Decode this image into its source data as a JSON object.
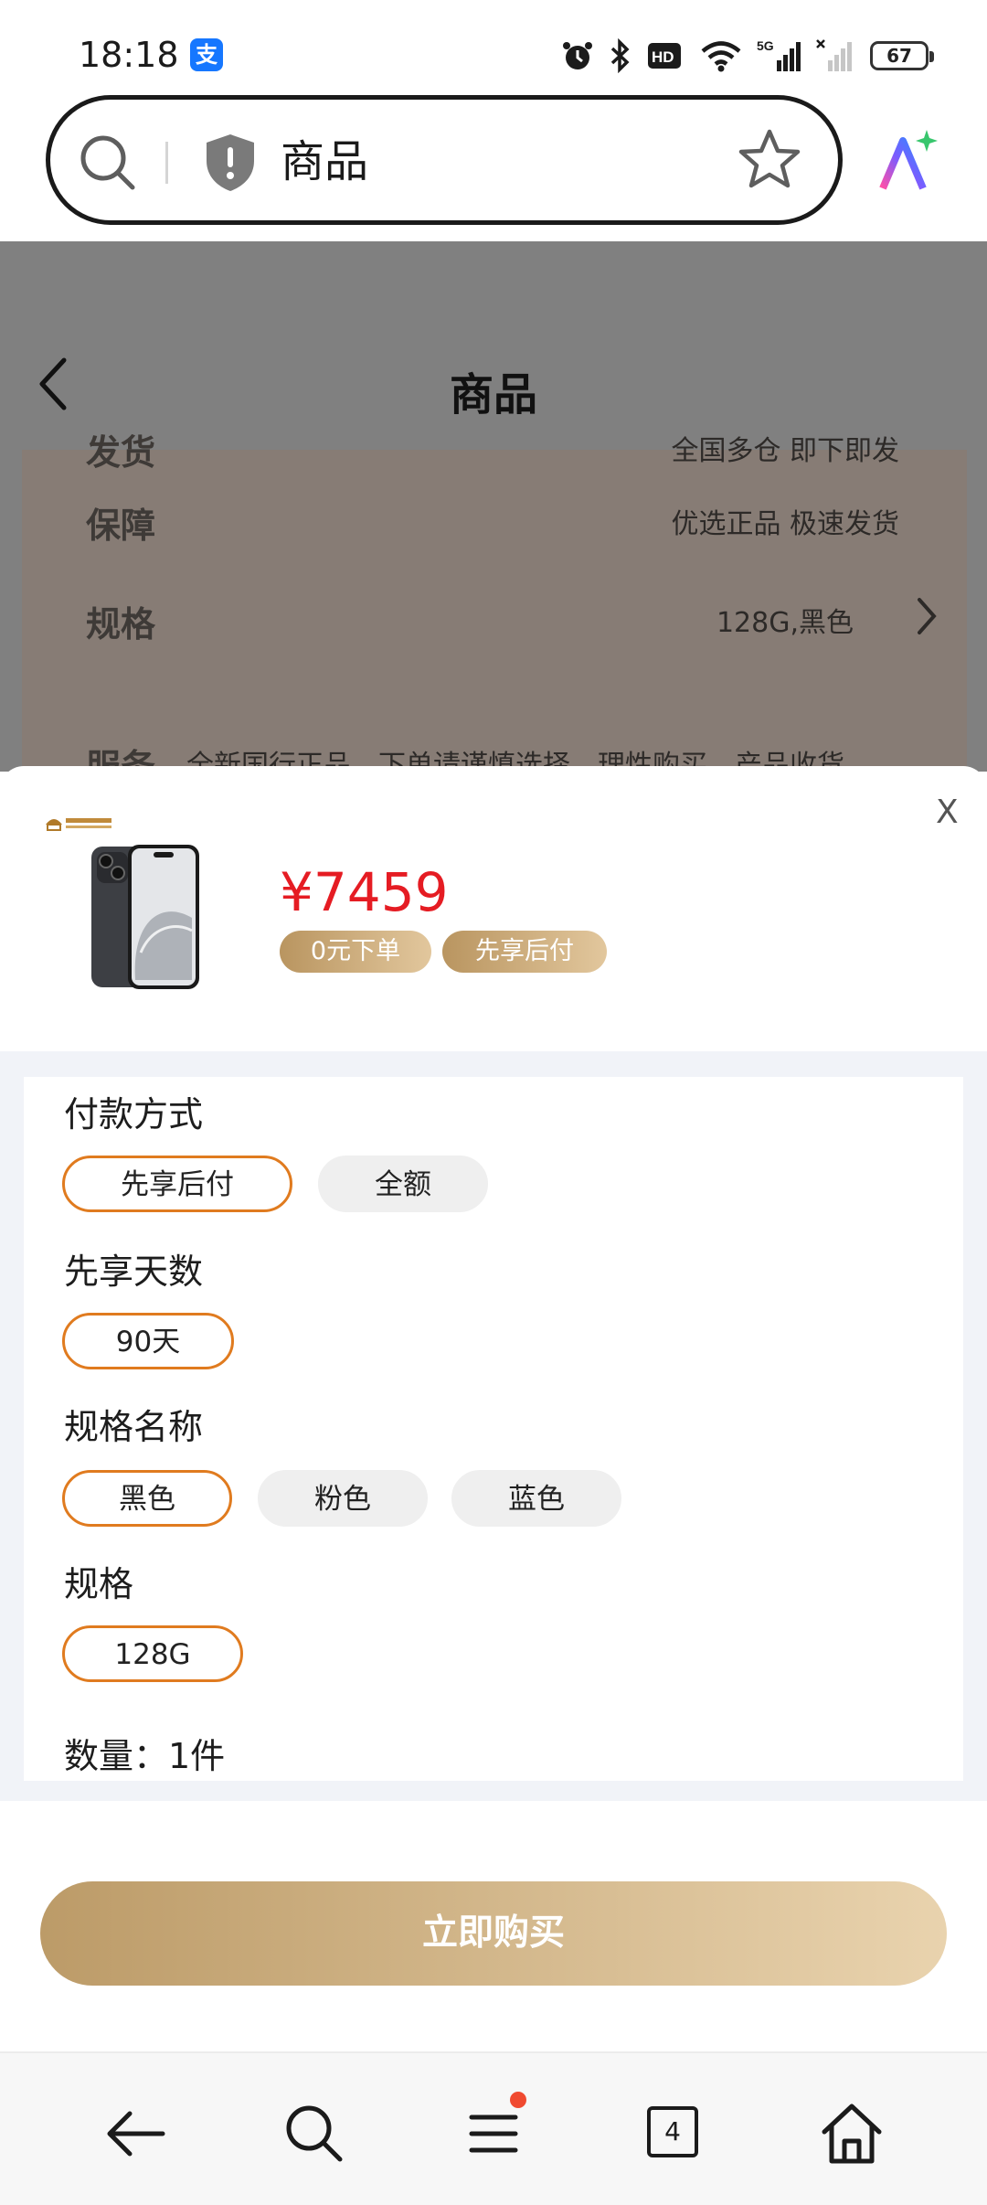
{
  "status_bar": {
    "time": "18:18",
    "app_badge": "支",
    "network": "5G",
    "battery": "67",
    "icons": [
      "alarm-icon",
      "bluetooth-icon",
      "hd-icon",
      "wifi-icon",
      "signal-icon",
      "signal-weak-icon",
      "battery-icon"
    ]
  },
  "browser": {
    "address_text": "商品",
    "icons": [
      "search-icon",
      "shield-icon",
      "star-icon",
      "ai-assistant-icon"
    ]
  },
  "page": {
    "title": "商品",
    "rows": [
      {
        "label": "发货",
        "value": "全国多仓 即下即发"
      },
      {
        "label": "保障",
        "value": "优选正品 极速发货"
      },
      {
        "label": "规格",
        "value": "128G,黑色"
      },
      {
        "label": "服务",
        "value": "全新国行正品，下单请谨慎选择，理性购买。产品收货"
      }
    ]
  },
  "sheet": {
    "close_label": "X",
    "price": "¥7459",
    "tags": [
      "0元下单",
      "先享后付"
    ],
    "groups": [
      {
        "title": "付款方式",
        "options": [
          "先享后付",
          "全额"
        ],
        "selected": "先享后付"
      },
      {
        "title": "先享天数",
        "options": [
          "90天"
        ],
        "selected": "90天"
      },
      {
        "title": "规格名称",
        "options": [
          "黑色",
          "粉色",
          "蓝色"
        ],
        "selected": "黑色"
      },
      {
        "title": "规格",
        "options": [
          "128G"
        ],
        "selected": "128G"
      }
    ],
    "quantity": "数量：1件",
    "buy_label": "立即购买"
  },
  "colors": {
    "accent_orange": "#e07b1f",
    "price_red": "#e51c23",
    "gold_start": "#bc9b68",
    "gold_end": "#e9d3ae"
  },
  "bottom_nav": {
    "tab_count": "4",
    "icons": [
      "back-arrow-icon",
      "search-icon",
      "menu-icon",
      "tabs-icon",
      "home-icon"
    ]
  }
}
